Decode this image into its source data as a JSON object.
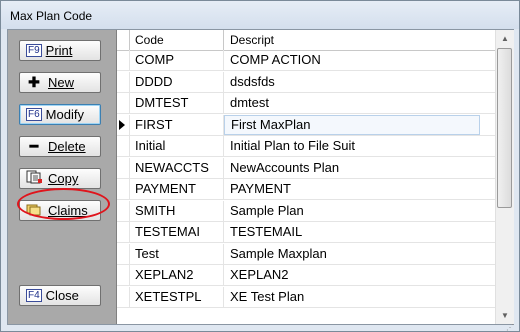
{
  "window": {
    "title": "Max Plan Code"
  },
  "sidebar": {
    "print": {
      "key": "F9",
      "label": "Print"
    },
    "new": {
      "icon": "plus-icon",
      "label": "New"
    },
    "modify": {
      "key": "F6",
      "label": "Modify"
    },
    "delete": {
      "icon": "minus-icon",
      "label": "Delete"
    },
    "copy": {
      "icon": "copy-icon",
      "label": "Copy"
    },
    "claims": {
      "icon": "folders-icon",
      "label": "Claims"
    },
    "close": {
      "key": "F4",
      "label": "Close"
    }
  },
  "grid": {
    "columns": [
      "Code",
      "Descript"
    ],
    "rows": [
      {
        "code": "COMP",
        "desc": "COMP ACTION"
      },
      {
        "code": "DDDD",
        "desc": "dsdsfds"
      },
      {
        "code": "DMTEST",
        "desc": "dmtest"
      },
      {
        "code": "FIRST",
        "desc": "First MaxPlan",
        "selected": true
      },
      {
        "code": "Initial",
        "desc": "Initial Plan to File Suit"
      },
      {
        "code": "NEWACCTS",
        "desc": "NewAccounts Plan"
      },
      {
        "code": "PAYMENT",
        "desc": "PAYMENT"
      },
      {
        "code": "SMITH",
        "desc": "Sample Plan"
      },
      {
        "code": "TESTEMAI",
        "desc": "TESTEMAIL"
      },
      {
        "code": "Test",
        "desc": "Sample Maxplan"
      },
      {
        "code": "XEPLAN2",
        "desc": "XEPLAN2"
      },
      {
        "code": "XETESTPL",
        "desc": "XE Test Plan"
      }
    ]
  },
  "colors": {
    "highlight_ellipse": "#e0141c",
    "sidebar_bg": "#a9a9a9"
  }
}
